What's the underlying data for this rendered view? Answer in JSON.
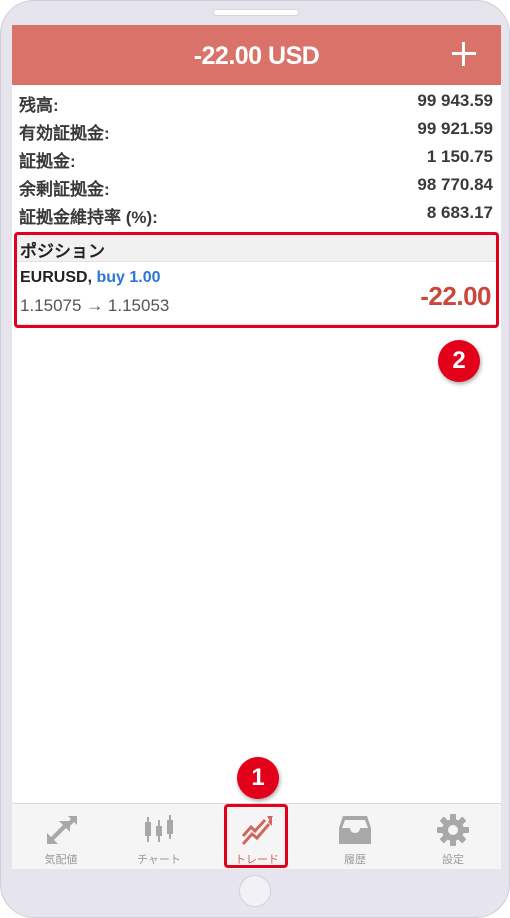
{
  "header": {
    "title": "-22.00 USD",
    "add_icon": "plus-icon"
  },
  "summary": [
    {
      "label": "残高:",
      "value": "99 943.59"
    },
    {
      "label": "有効証拠金:",
      "value": "99 921.59"
    },
    {
      "label": "証拠金:",
      "value": "1 150.75"
    },
    {
      "label": "余剰証拠金:",
      "value": "98 770.84"
    },
    {
      "label": "証拠金維持率 (%):",
      "value": "8 683.17"
    }
  ],
  "positions": {
    "title": "ポジション",
    "items": [
      {
        "symbol": "EURUSD,",
        "side": "buy 1.00",
        "open_price": "1.15075",
        "arrow": "→",
        "current_price": "1.15053",
        "profit": "-22.00"
      }
    ]
  },
  "annotations": {
    "badge_1": "1",
    "badge_2": "2"
  },
  "tabs": [
    {
      "label": "気配値",
      "icon": "quotes-arrows-icon",
      "active": false
    },
    {
      "label": "チャート",
      "icon": "candlestick-icon",
      "active": false
    },
    {
      "label": "トレード",
      "icon": "trade-trend-icon",
      "active": true
    },
    {
      "label": "履歴",
      "icon": "inbox-history-icon",
      "active": false
    },
    {
      "label": "設定",
      "icon": "gear-icon",
      "active": false
    }
  ],
  "colors": {
    "header_bg": "#d97268",
    "buy_text": "#2a77d6",
    "loss_text": "#c9473b",
    "annotation": "#e2001a",
    "tab_inactive": "#9a9a9a",
    "tab_active": "#d0675c"
  }
}
